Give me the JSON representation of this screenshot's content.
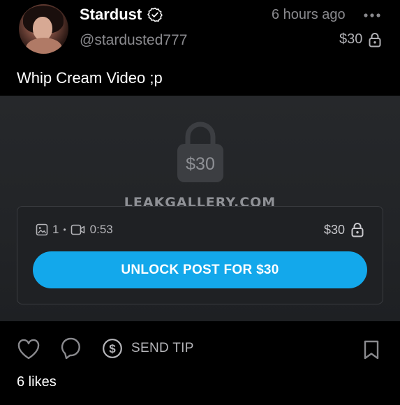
{
  "post": {
    "author": {
      "display_name": "Stardust",
      "username": "@stardusted777",
      "avatar_icon": "avatar-photo",
      "verified_icon": "verified-badge-icon"
    },
    "timestamp": "6 hours ago",
    "price_label": "$30",
    "caption": "Whip Cream Video ;p"
  },
  "locked_media": {
    "lock_price": "$30",
    "watermark": "LEAKGALLERY.COM",
    "image_count": "1",
    "separator": "•",
    "video_duration": "0:53",
    "card_price": "$30",
    "unlock_label": "UNLOCK POST FOR $30"
  },
  "actions": {
    "send_tip_label": "SEND TIP",
    "likes_label": "6 likes"
  },
  "colors": {
    "accent": "#13a8eb",
    "background": "#000000",
    "muted_text": "#8a8a8e",
    "media_bg": "#25272a"
  }
}
